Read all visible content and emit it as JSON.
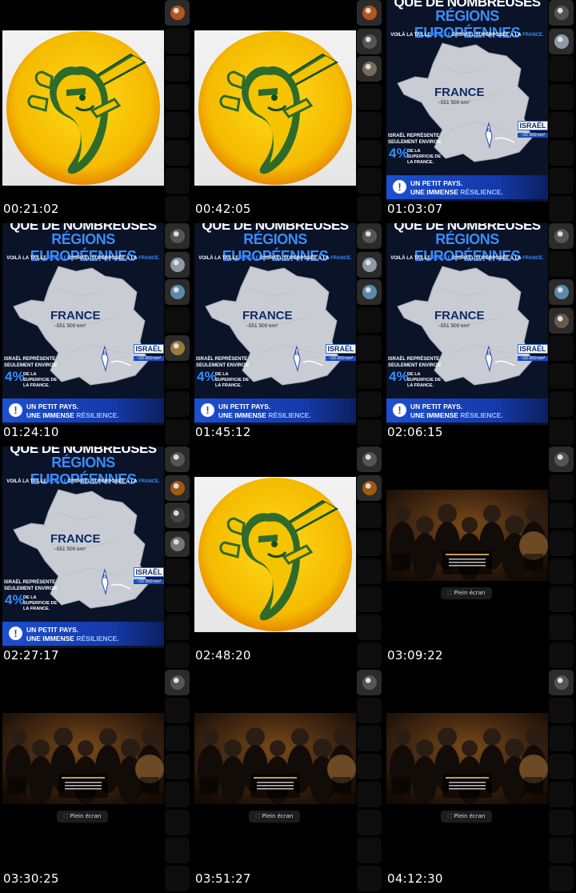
{
  "timestamps": [
    "00:21:02",
    "00:42:05",
    "01:03:07",
    "01:24:10",
    "01:45:12",
    "02:06:15",
    "02:27:17",
    "02:48:20",
    "03:09:22",
    "03:30:25",
    "03:51:27",
    "04:12:30"
  ],
  "frames": [
    "logo",
    "logo",
    "map",
    "map",
    "map",
    "map",
    "map",
    "logo",
    "concert",
    "concert",
    "concert",
    "concert"
  ],
  "poster": {
    "title_line1": "QUE DE NOMBREUSES",
    "title_line2": "RÉGIONS EUROPÉENNES",
    "subtitle_pre": "VOILÀ LA TAILLE",
    "subtitle_hl": "RÉELLE",
    "subtitle_mid": "D'ISRAËL SUPERPOSÉE À LA",
    "subtitle_end": "FRANCE.",
    "france_label": "FRANCE",
    "france_size": "~551 500 km²",
    "israel_label": "ISRAËL",
    "israel_size": "~22 000 km²",
    "represents": "ISRAËL REPRÉSENTE SEULEMENT ENVIRON",
    "percent": "4%",
    "percent_text": "DE LA SUPERFICIE DE LA FRANCE.",
    "banner_line1": "UN PETIT PAYS.",
    "banner_line2_a": "UNE IMMENSE",
    "banner_line2_b": "RÉSILIENCE."
  },
  "fullscreen_label": "Plein écran",
  "colors": {
    "background": "#000000",
    "poster_blue": "#3a8dff",
    "banner": "#1c4fd0",
    "logo_yellow": "#f5c400",
    "logo_green": "#2e6b2a"
  }
}
